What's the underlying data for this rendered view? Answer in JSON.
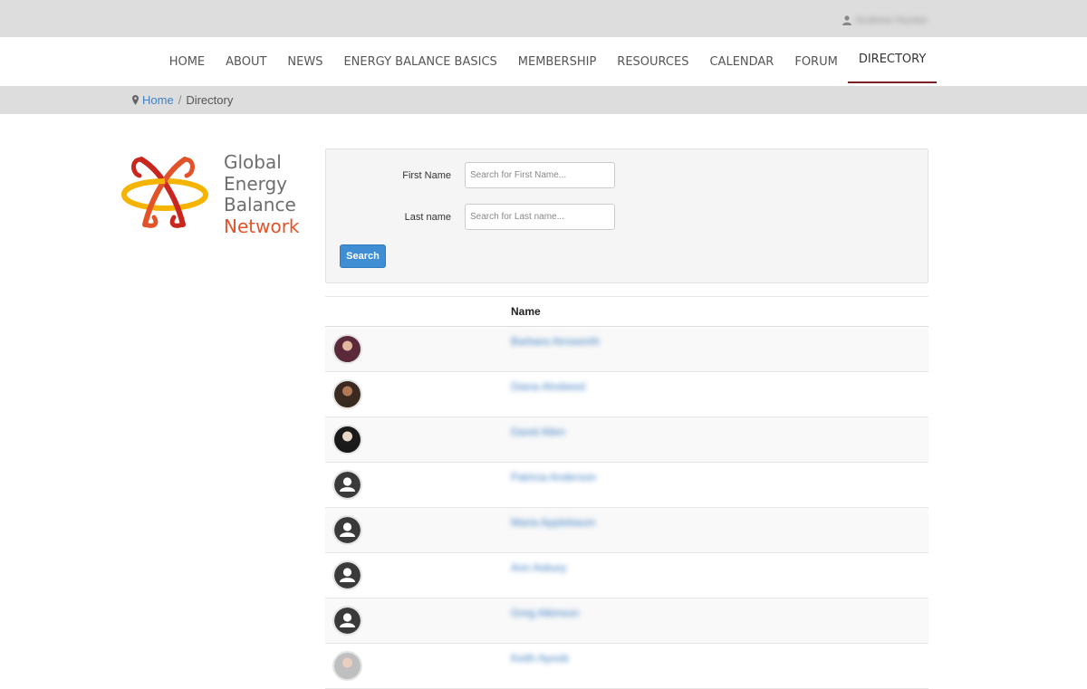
{
  "header": {
    "user_name": "Andrew Hunter"
  },
  "nav": {
    "items": [
      "HOME",
      "ABOUT",
      "NEWS",
      "ENERGY BALANCE BASICS",
      "MEMBERSHIP",
      "RESOURCES",
      "CALENDAR",
      "FORUM",
      "DIRECTORY"
    ],
    "active": "DIRECTORY"
  },
  "breadcrumb": {
    "home": "Home",
    "separator": "/",
    "current": "Directory"
  },
  "logo": {
    "line1": "Global",
    "line2": "Energy",
    "line3": "Balance",
    "line4": "Network"
  },
  "search": {
    "first_label": "First Name",
    "first_placeholder": "Search for First Name...",
    "last_label": "Last name",
    "last_placeholder": "Search for Last name...",
    "button": "Search"
  },
  "table": {
    "header": "Name",
    "rows": [
      {
        "name": "Barbara Ainsworth",
        "avatar": "photo"
      },
      {
        "name": "Diana Ahobeed",
        "avatar": "photo"
      },
      {
        "name": "David Allen",
        "avatar": "photo"
      },
      {
        "name": "Patricia Anderson",
        "avatar": "placeholder"
      },
      {
        "name": "Maria Applebaum",
        "avatar": "placeholder"
      },
      {
        "name": "Ann Asbury",
        "avatar": "placeholder"
      },
      {
        "name": "Greg Atkinson",
        "avatar": "placeholder"
      },
      {
        "name": "Keith Ayoob",
        "avatar": "photo"
      }
    ]
  },
  "colors": {
    "accent": "#7b2027",
    "link": "#3f7fc3",
    "button": "#3f8ed3",
    "logo_orange": "#e2532a"
  }
}
